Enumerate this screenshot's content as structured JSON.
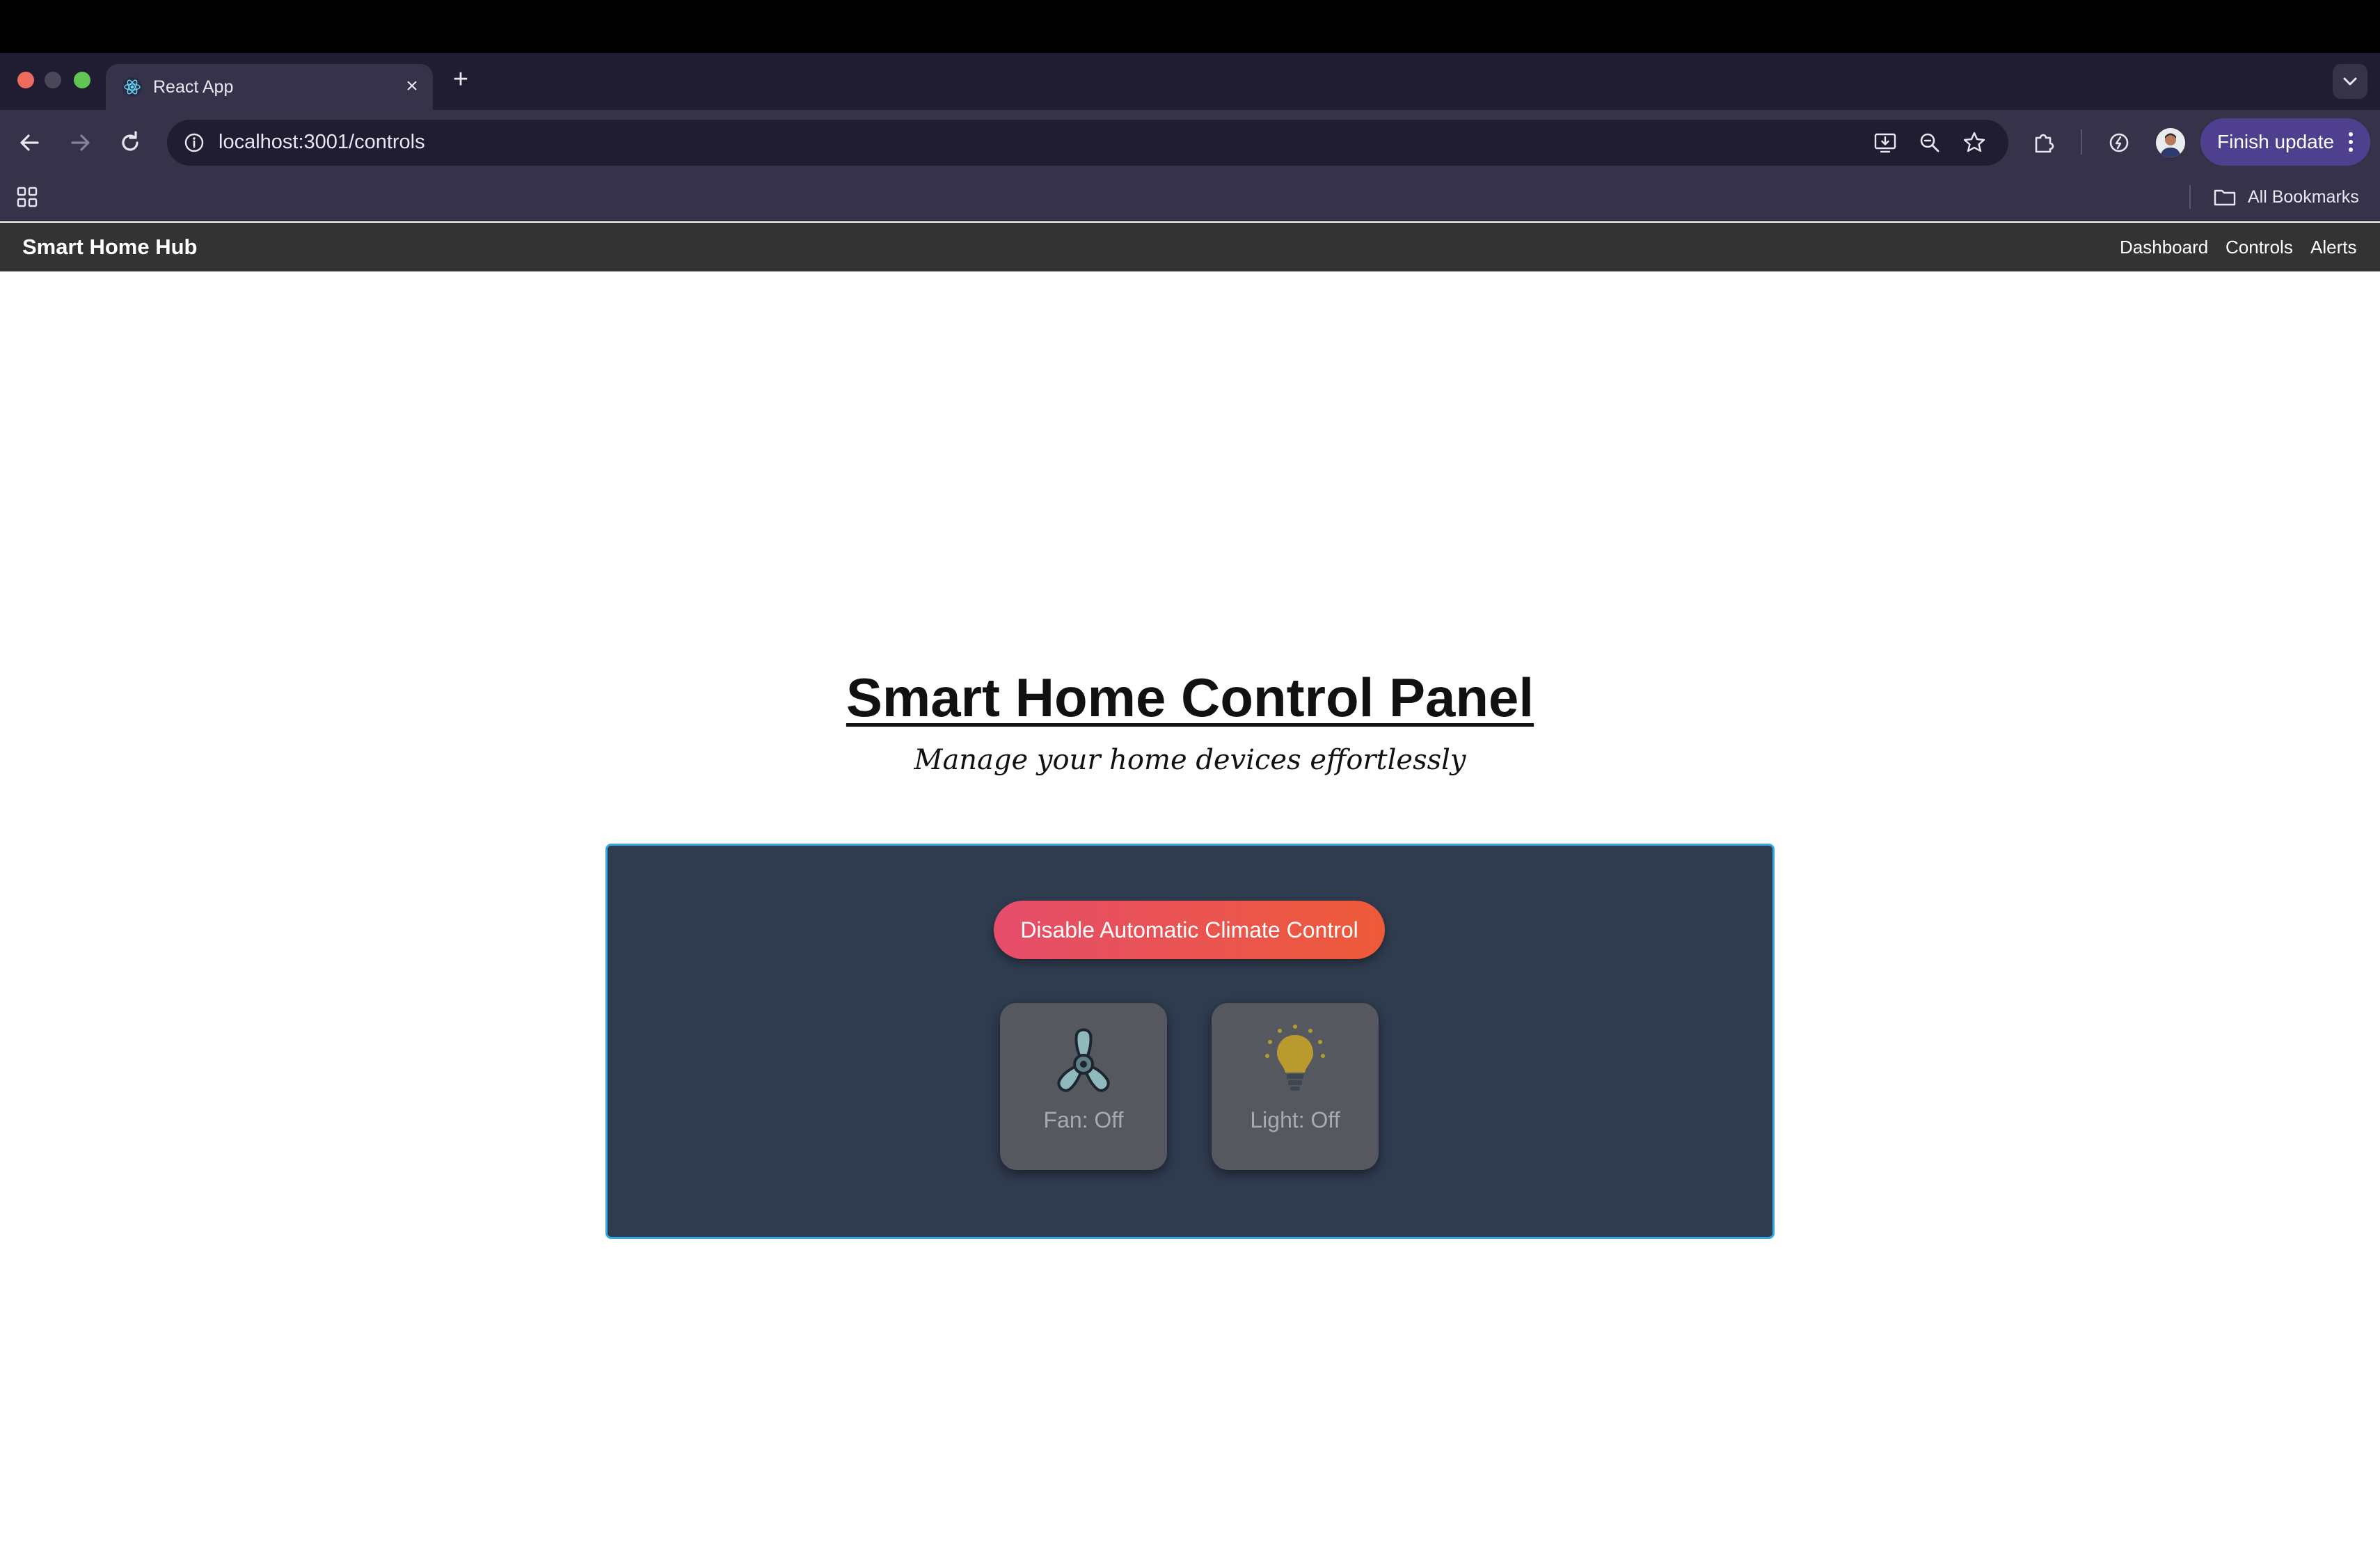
{
  "browser": {
    "tab_title": "React App",
    "url": "localhost:3001/controls",
    "finish_update_label": "Finish update",
    "bookmarks_label": "All Bookmarks"
  },
  "app_nav": {
    "brand": "Smart Home Hub",
    "links": [
      "Dashboard",
      "Controls",
      "Alerts"
    ]
  },
  "page": {
    "title": "Smart Home Control Panel",
    "subtitle": "Manage your home devices effortlessly"
  },
  "controls": {
    "climate_button_label": "Disable Automatic Climate Control",
    "devices": [
      {
        "icon": "fan-icon",
        "label": "Fan: Off"
      },
      {
        "icon": "lightbulb-icon",
        "label": "Light: Off"
      }
    ]
  },
  "colors": {
    "panel_background": "#2f3b4f",
    "panel_border": "#38a9e0",
    "button_gradient_start": "#e54d6b",
    "button_gradient_end": "#ee5a38",
    "app_nav_background": "#333333"
  }
}
